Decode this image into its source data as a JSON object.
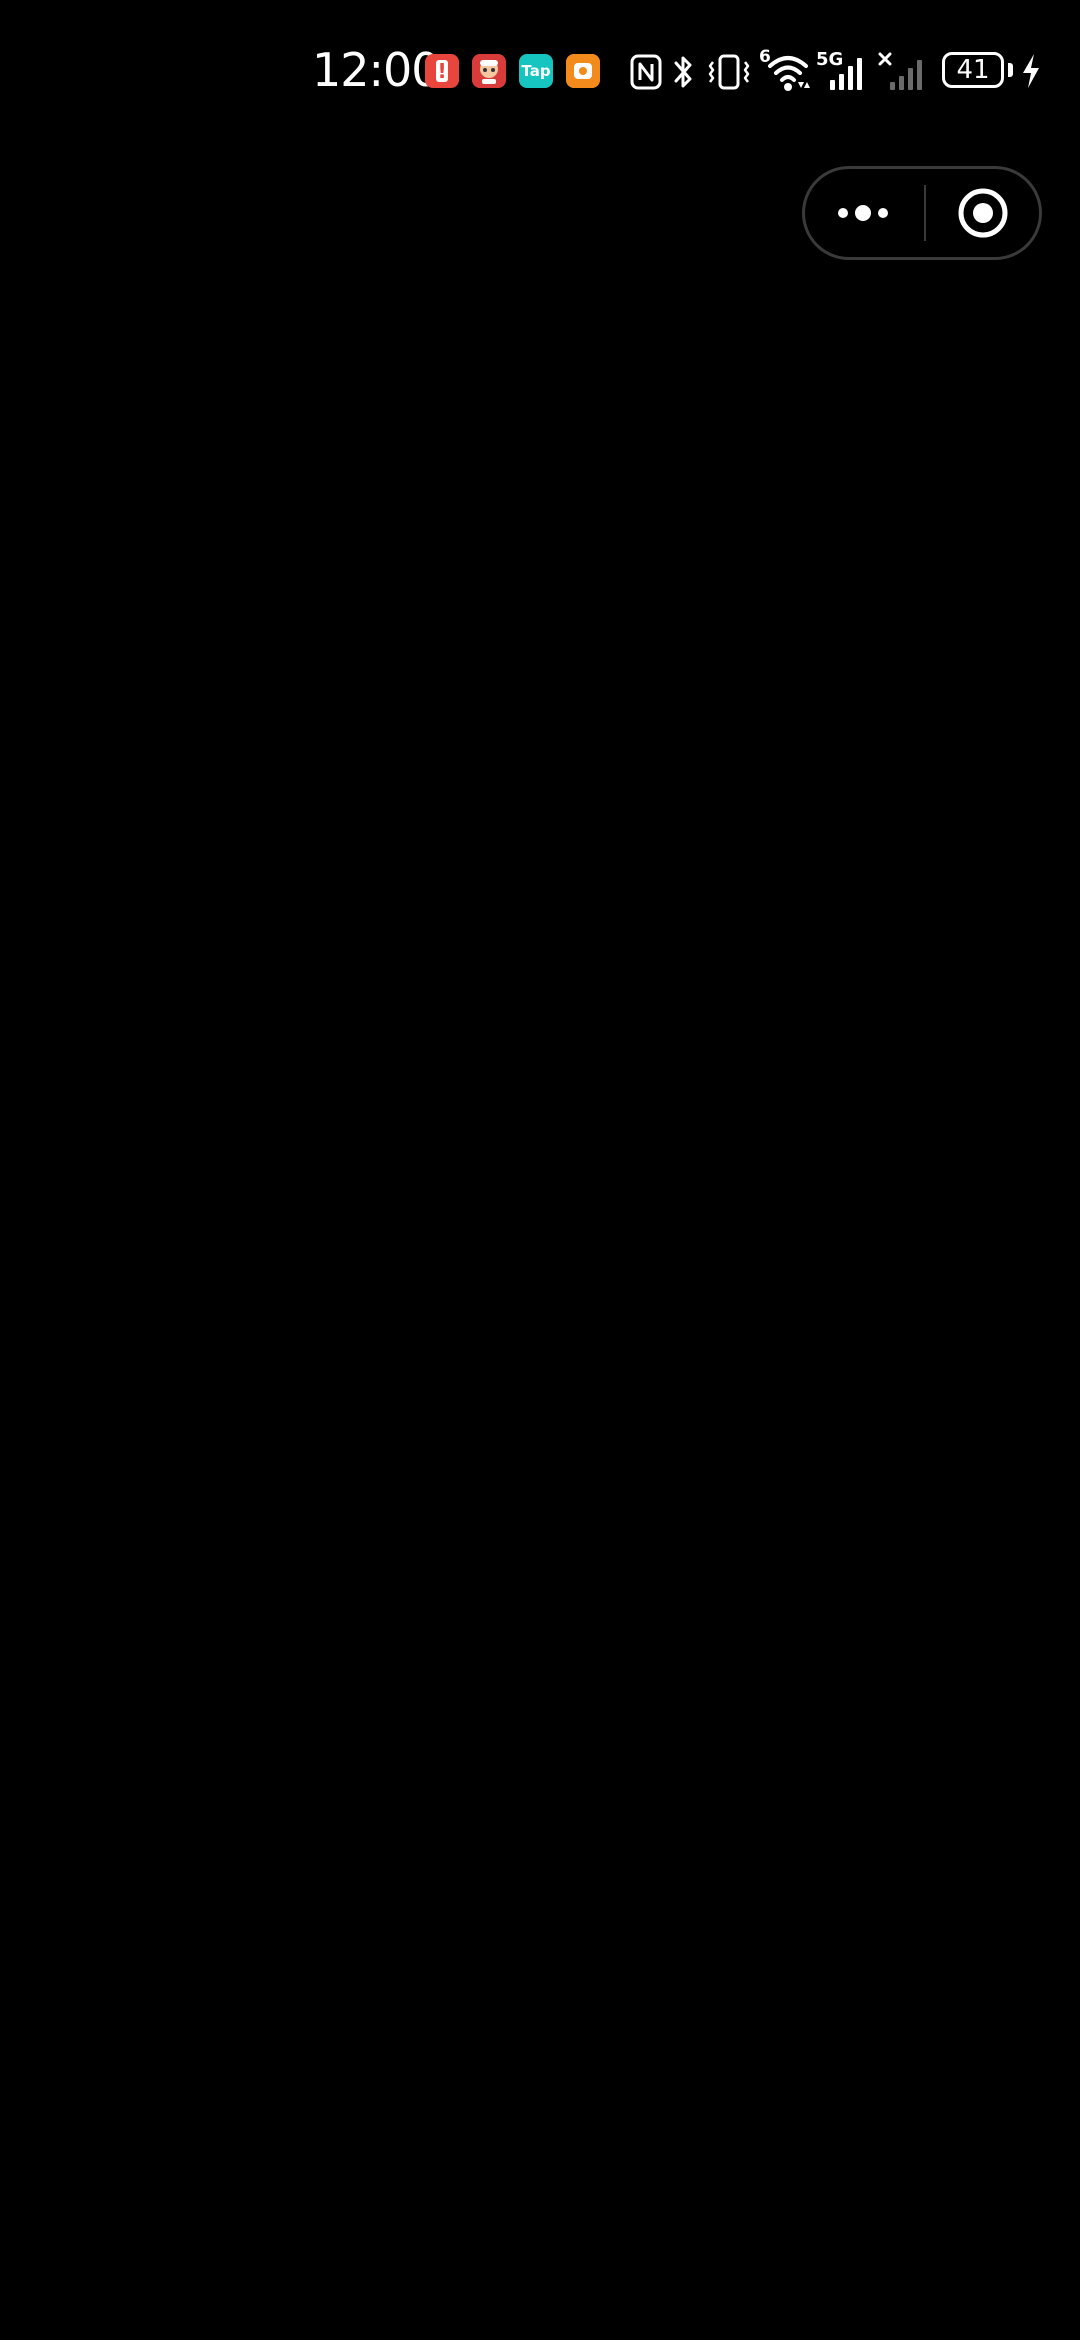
{
  "status_bar": {
    "time": "12:00",
    "notifications": [
      {
        "name": "alert-app-icon",
        "label": "!",
        "color": "#e8453c"
      },
      {
        "name": "game-app-icon",
        "label": "",
        "color": "#d93a3a"
      },
      {
        "name": "taptap-app-icon",
        "label": "Tap",
        "color": "#16c5c0"
      },
      {
        "name": "orange-app-icon",
        "label": "",
        "color": "#f28a1c"
      }
    ],
    "wifi_badge": "6",
    "cellular_label": "5G",
    "battery_level": "41",
    "colors": {
      "background": "#000000",
      "foreground": "#ffffff",
      "inactive_signal": "#6b6b6b"
    }
  },
  "capsule": {
    "more_icon": "more-dots-icon",
    "close_icon": "record-circle-icon",
    "border_color": "#3a3a3a"
  },
  "page": {
    "background": "#000000"
  }
}
